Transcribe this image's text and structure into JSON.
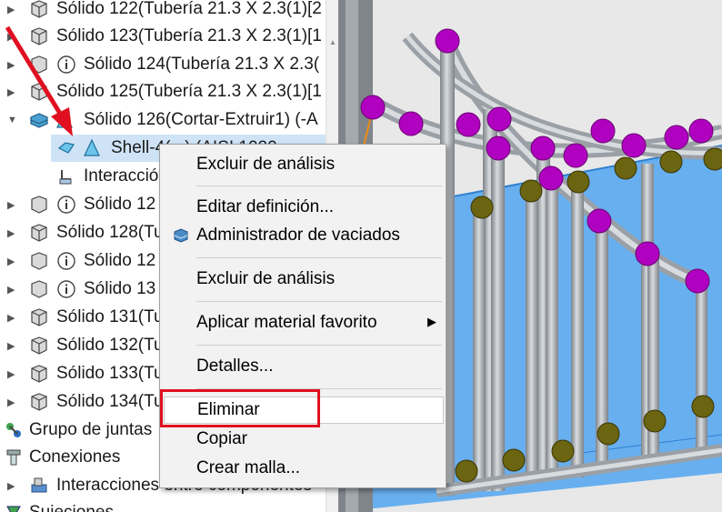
{
  "tree": {
    "items": [
      {
        "label": "Sólido 122(Tubería 21.3 X 2.3(1)[2",
        "icon": "solid-body-icon"
      },
      {
        "label": "Sólido 123(Tubería 21.3 X 2.3(1)[1",
        "icon": "solid-body-icon"
      },
      {
        "label": "Sólido 124(Tubería 21.3 X 2.3(",
        "icon": "info-icon"
      },
      {
        "label": "Sólido 125(Tubería 21.3 X 2.3(1)[1",
        "icon": "solid-body-icon"
      },
      {
        "label": "Sólido 126(Cortar-Extruir1) (-A",
        "icon": "cut-extrude-body-icon"
      },
      {
        "label": "Shell-4(...) (AISI 1020",
        "icon": "shell-icon"
      },
      {
        "label": "Interacció",
        "icon": "interaction-icon"
      },
      {
        "label": "Sólido 12",
        "icon": "info-icon"
      },
      {
        "label": "Sólido 128(Tu",
        "icon": "solid-body-icon"
      },
      {
        "label": "Sólido 12",
        "icon": "info-icon"
      },
      {
        "label": "Sólido 13",
        "icon": "info-icon"
      },
      {
        "label": "Sólido 131(Tu",
        "icon": "solid-body-icon"
      },
      {
        "label": "Sólido 132(Tu",
        "icon": "solid-body-icon"
      },
      {
        "label": "Sólido 133(Tu",
        "icon": "solid-body-icon"
      },
      {
        "label": "Sólido 134(Tu",
        "icon": "solid-body-icon"
      },
      {
        "label": "Grupo de juntas",
        "icon": "joint-group-icon"
      },
      {
        "label": "Conexiones",
        "icon": "connections-icon"
      },
      {
        "label": "Interacciones entre componentes",
        "icon": "component-interaction-icon"
      },
      {
        "label": "Sujeciones",
        "icon": "fixtures-icon"
      }
    ]
  },
  "context_menu": {
    "items": [
      {
        "label": "Excluir de análisis"
      },
      {
        "label": "Editar definición..."
      },
      {
        "label": "Administrador de vaciados",
        "icon": "shell-manager-icon"
      },
      {
        "label": "Excluir de análisis"
      },
      {
        "label": "Aplicar material favorito",
        "submenu": "▶"
      },
      {
        "label": "Detalles..."
      },
      {
        "label": "Eliminar"
      },
      {
        "label": "Copiar"
      },
      {
        "label": "Crear malla..."
      }
    ],
    "highlighted_item": "Eliminar"
  },
  "colors": {
    "selection": "#cfe3f7",
    "annotation_red": "#e01020",
    "joint_magenta": "#b000c0",
    "joint_olive": "#6b6410",
    "plane_blue": "#5aa8f0",
    "pipe_gray": "#a7acb2"
  }
}
